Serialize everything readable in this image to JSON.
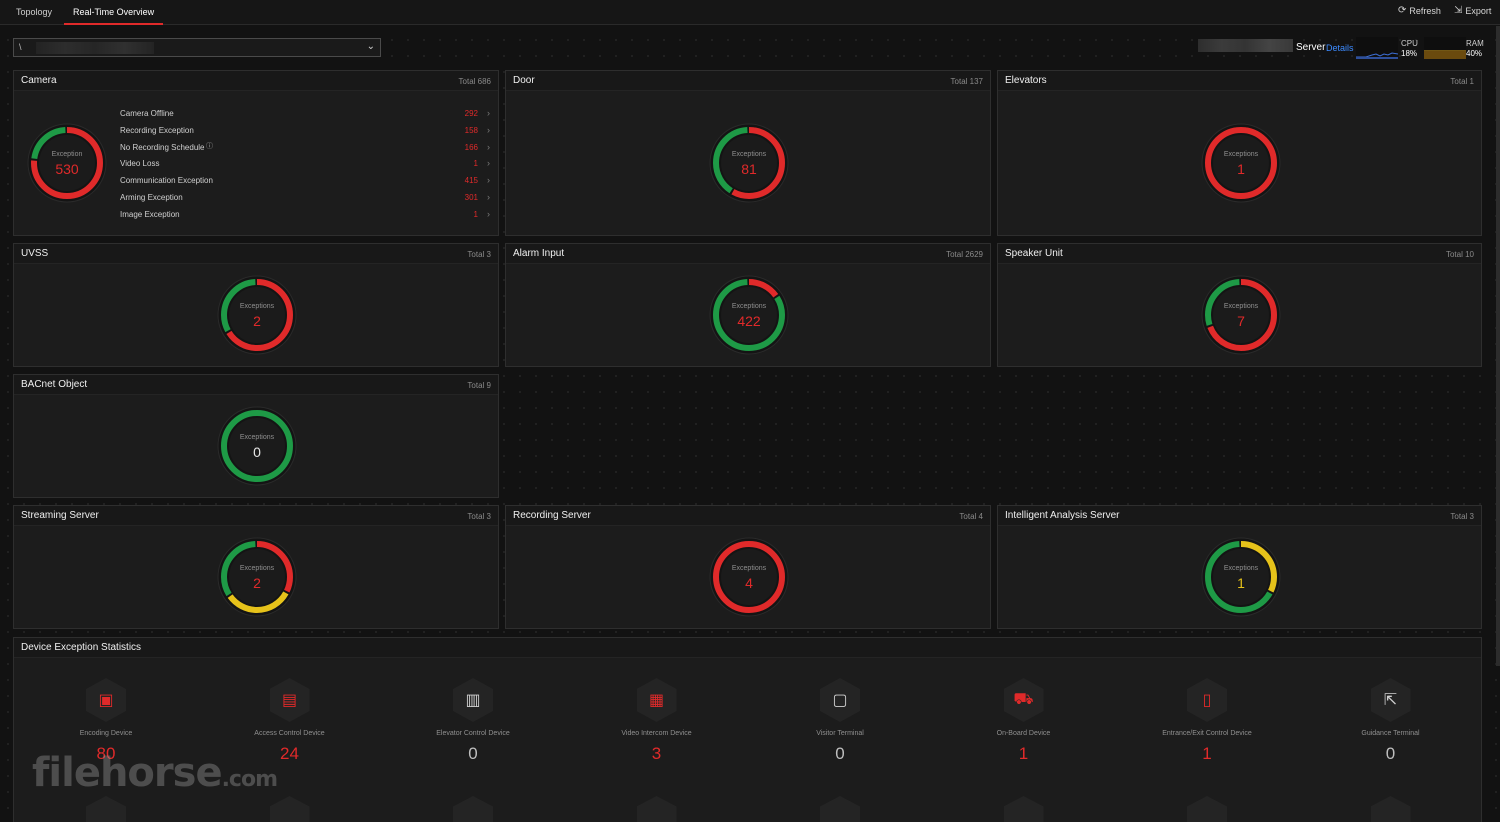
{
  "tabs": [
    {
      "label": "Topology",
      "active": false
    },
    {
      "label": "Real-Time Overview",
      "active": true
    }
  ],
  "actions": {
    "refresh": "Refresh",
    "export": "Export"
  },
  "selector": {
    "value": "\\"
  },
  "server": {
    "label": "Server",
    "details": "Details",
    "cpu_label": "CPU",
    "cpu_value": "18%",
    "ram_label": "RAM",
    "ram_value": "40%"
  },
  "colors": {
    "exception": "#e02a2a",
    "normal": "#1e9a46",
    "warning": "#e6c21a",
    "link": "#3d8bff"
  },
  "panels": {
    "camera": {
      "title": "Camera",
      "total": "Total 686",
      "donut_label": "Exception",
      "exceptions": "530",
      "exception_fraction": 0.77
    },
    "door": {
      "title": "Door",
      "total": "Total 137",
      "donut_label": "Exceptions",
      "exceptions": "81",
      "exception_fraction": 0.59
    },
    "elevators": {
      "title": "Elevators",
      "total": "Total 1",
      "donut_label": "Exceptions",
      "exceptions": "1",
      "exception_fraction": 1.0
    },
    "uvss": {
      "title": "UVSS",
      "total": "Total 3",
      "donut_label": "Exceptions",
      "exceptions": "2",
      "exception_fraction": 0.67
    },
    "alarm_input": {
      "title": "Alarm Input",
      "total": "Total 2629",
      "donut_label": "Exceptions",
      "exceptions": "422",
      "exception_fraction": 0.16
    },
    "speaker_unit": {
      "title": "Speaker Unit",
      "total": "Total 10",
      "donut_label": "Exceptions",
      "exceptions": "7",
      "exception_fraction": 0.7
    },
    "bacnet": {
      "title": "BACnet Object",
      "total": "Total 9",
      "donut_label": "Exceptions",
      "exceptions": "0",
      "exception_fraction": 0.0
    },
    "streaming": {
      "title": "Streaming Server",
      "total": "Total 3",
      "donut_label": "Exceptions",
      "exceptions": "2",
      "exception_fraction": 0.33,
      "warning_fraction": 0.33
    },
    "recording": {
      "title": "Recording Server",
      "total": "Total 4",
      "donut_label": "Exceptions",
      "exceptions": "4",
      "exception_fraction": 1.0
    },
    "intelligent": {
      "title": "Intelligent Analysis Server",
      "total": "Total 3",
      "donut_label": "Exceptions",
      "exceptions": "1",
      "exception_fraction": 0.0,
      "warning_fraction": 0.33
    }
  },
  "camera_items": [
    {
      "label": "Camera Offline",
      "value": "292"
    },
    {
      "label": "Recording Exception",
      "value": "158"
    },
    {
      "label": "No Recording Schedule",
      "value": "166"
    },
    {
      "label": "Video Loss",
      "value": "1"
    },
    {
      "label": "Communication Exception",
      "value": "415"
    },
    {
      "label": "Arming Exception",
      "value": "301"
    },
    {
      "label": "Image Exception",
      "value": "1"
    }
  ],
  "device_stats": {
    "title": "Device Exception Statistics",
    "items": [
      {
        "name": "Encoding Device",
        "count": "80",
        "icon": "encoding-device-icon",
        "glyph": "▣"
      },
      {
        "name": "Access Control Device",
        "count": "24",
        "icon": "access-control-icon",
        "glyph": "▤"
      },
      {
        "name": "Elevator Control Device",
        "count": "0",
        "icon": "elevator-control-icon",
        "glyph": "▥"
      },
      {
        "name": "Video Intercom Device",
        "count": "3",
        "icon": "video-intercom-icon",
        "glyph": "▦"
      },
      {
        "name": "Visitor Terminal",
        "count": "0",
        "icon": "visitor-terminal-icon",
        "glyph": "▢"
      },
      {
        "name": "On-Board Device",
        "count": "1",
        "icon": "onboard-device-icon",
        "glyph": "⛟"
      },
      {
        "name": "Entrance/Exit Control Device",
        "count": "1",
        "icon": "entrance-exit-icon",
        "glyph": "▯"
      },
      {
        "name": "Guidance Terminal",
        "count": "0",
        "icon": "guidance-terminal-icon",
        "glyph": "⇱"
      }
    ]
  },
  "watermark": {
    "text": "filehorse",
    "suffix": ".com"
  }
}
